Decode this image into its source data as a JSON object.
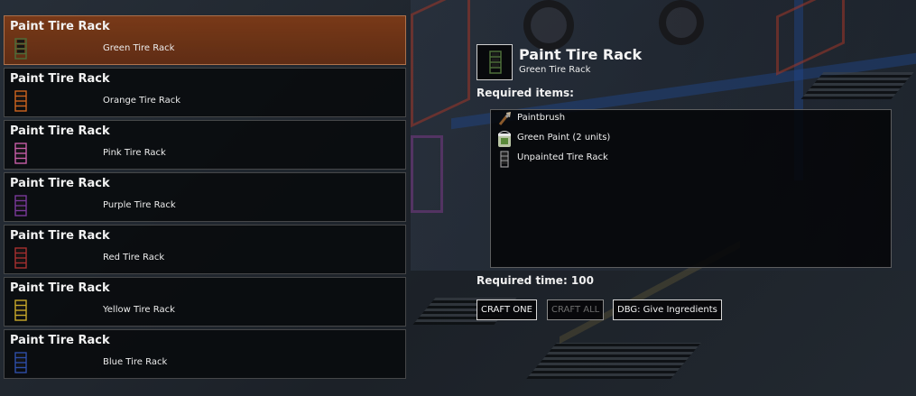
{
  "recipes": [
    {
      "title": "Paint Tire Rack",
      "subtitle": "Green Tire Rack",
      "icon": "green-tire-rack-icon",
      "color": "#4d6e3a",
      "selected": true
    },
    {
      "title": "Paint Tire Rack",
      "subtitle": "Orange Tire Rack",
      "icon": "orange-tire-rack-icon",
      "color": "#d0651f",
      "selected": false
    },
    {
      "title": "Paint Tire Rack",
      "subtitle": "Pink Tire Rack",
      "icon": "pink-tire-rack-icon",
      "color": "#c85fa8",
      "selected": false
    },
    {
      "title": "Paint Tire Rack",
      "subtitle": "Purple Tire Rack",
      "icon": "purple-tire-rack-icon",
      "color": "#7a3a9a",
      "selected": false
    },
    {
      "title": "Paint Tire Rack",
      "subtitle": "Red Tire Rack",
      "icon": "red-tire-rack-icon",
      "color": "#a83030",
      "selected": false
    },
    {
      "title": "Paint Tire Rack",
      "subtitle": "Yellow Tire Rack",
      "icon": "yellow-tire-rack-icon",
      "color": "#c9a82a",
      "selected": false
    },
    {
      "title": "Paint Tire Rack",
      "subtitle": "Blue Tire Rack",
      "icon": "blue-tire-rack-icon",
      "color": "#2f4fa8",
      "selected": false
    }
  ],
  "detail": {
    "title": "Paint Tire Rack",
    "subtitle": "Green Tire Rack",
    "icon": "green-tire-rack-icon",
    "required_items_label": "Required items:",
    "items": [
      {
        "name": "Paintbrush",
        "icon": "paintbrush-icon"
      },
      {
        "name": "Green Paint (2 units)",
        "icon": "green-paint-can-icon"
      },
      {
        "name": "Unpainted Tire Rack",
        "icon": "unpainted-tire-rack-icon"
      }
    ],
    "required_time_label": "Required time: 100"
  },
  "buttons": {
    "craft_one": "CRAFT ONE",
    "craft_all": "CRAFT ALL",
    "give_ingredients": "DBG: Give Ingredients"
  }
}
